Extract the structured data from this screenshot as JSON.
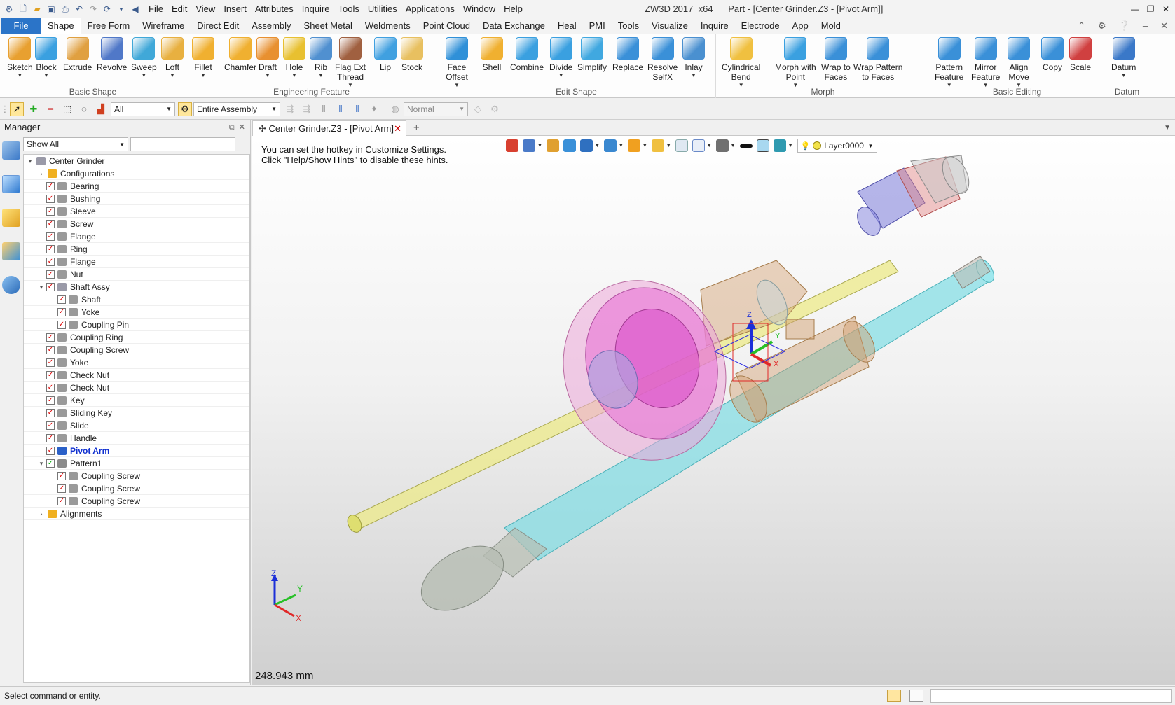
{
  "title_bar": {
    "menus": [
      "File",
      "Edit",
      "View",
      "Insert",
      "Attributes",
      "Inquire",
      "Tools",
      "Utilities",
      "Applications",
      "Window",
      "Help"
    ],
    "app_name": "ZW3D 2017",
    "arch": "x64",
    "window_title": "Part - [Center Grinder.Z3 - [Pivot Arm]]"
  },
  "ribbon_tabs": [
    "File",
    "Shape",
    "Free Form",
    "Wireframe",
    "Direct Edit",
    "Assembly",
    "Sheet Metal",
    "Weldments",
    "Point Cloud",
    "Data Exchange",
    "Heal",
    "PMI",
    "Tools",
    "Visualize",
    "Inquire",
    "Electrode",
    "App",
    "Mold"
  ],
  "active_tab": "Shape",
  "ribbon_groups": [
    {
      "label": "Basic Shape",
      "buttons": [
        {
          "l1": "Sketch",
          "l2": "",
          "arrow": true,
          "color": "#e8a030"
        },
        {
          "l1": "Block",
          "l2": "",
          "arrow": true,
          "color": "#3aa0e0"
        },
        {
          "l1": "Extrude",
          "l2": "",
          "arrow": false,
          "color": "#e0a040"
        },
        {
          "l1": "Revolve",
          "l2": "",
          "arrow": false,
          "color": "#5078c8"
        },
        {
          "l1": "Sweep",
          "l2": "",
          "arrow": true,
          "color": "#40a8d8"
        },
        {
          "l1": "Loft",
          "l2": "",
          "arrow": true,
          "color": "#e8b040"
        }
      ]
    },
    {
      "label": "Engineering Feature",
      "buttons": [
        {
          "l1": "Fillet",
          "l2": "",
          "arrow": true,
          "color": "#f0b030"
        },
        {
          "l1": "Chamfer",
          "l2": "",
          "arrow": false,
          "color": "#f0b030"
        },
        {
          "l1": "Draft",
          "l2": "",
          "arrow": true,
          "color": "#e89030"
        },
        {
          "l1": "Hole",
          "l2": "",
          "arrow": true,
          "color": "#e8c030"
        },
        {
          "l1": "Rib",
          "l2": "",
          "arrow": true,
          "color": "#5090d0"
        },
        {
          "l1": "Flag Ext",
          "l2": "Thread",
          "arrow": true,
          "color": "#a06040"
        },
        {
          "l1": "Lip",
          "l2": "",
          "arrow": false,
          "color": "#40a0e0"
        },
        {
          "l1": "Stock",
          "l2": "",
          "arrow": false,
          "color": "#e8c060"
        }
      ]
    },
    {
      "label": "Edit Shape",
      "buttons": [
        {
          "l1": "Face",
          "l2": "Offset",
          "arrow": true,
          "color": "#2f90d8"
        },
        {
          "l1": "Shell",
          "l2": "",
          "arrow": false,
          "color": "#f0b030"
        },
        {
          "l1": "Combine",
          "l2": "",
          "arrow": false,
          "color": "#3aa0e0"
        },
        {
          "l1": "Divide",
          "l2": "",
          "arrow": true,
          "color": "#3aa0e0"
        },
        {
          "l1": "Simplify",
          "l2": "",
          "arrow": false,
          "color": "#40a8e0"
        },
        {
          "l1": "Replace",
          "l2": "",
          "arrow": false,
          "color": "#3a90d8"
        },
        {
          "l1": "Resolve",
          "l2": "SelfX",
          "arrow": false,
          "color": "#3a90d8"
        },
        {
          "l1": "Inlay",
          "l2": "",
          "arrow": true,
          "color": "#4a90d0"
        }
      ]
    },
    {
      "label": "Morph",
      "buttons": [
        {
          "l1": "Cylindrical",
          "l2": "Bend",
          "arrow": true,
          "color": "#f0c040"
        },
        {
          "l1": "Morph with",
          "l2": "Point",
          "arrow": true,
          "color": "#3aa0e0"
        },
        {
          "l1": "Wrap to",
          "l2": "Faces",
          "arrow": false,
          "color": "#3a90d8"
        },
        {
          "l1": "Wrap Pattern",
          "l2": "to Faces",
          "arrow": false,
          "color": "#3a90d8"
        }
      ]
    },
    {
      "label": "Basic Editing",
      "buttons": [
        {
          "l1": "Pattern",
          "l2": "Feature",
          "arrow": true,
          "color": "#3a90d8"
        },
        {
          "l1": "Mirror",
          "l2": "Feature",
          "arrow": true,
          "color": "#3a90d8"
        },
        {
          "l1": "Align",
          "l2": "Move",
          "arrow": true,
          "color": "#3a90d8"
        },
        {
          "l1": "Copy",
          "l2": "",
          "arrow": false,
          "color": "#3a90d8"
        },
        {
          "l1": "Scale",
          "l2": "",
          "arrow": false,
          "color": "#d04040"
        }
      ]
    },
    {
      "label": "Datum",
      "buttons": [
        {
          "l1": "Datum",
          "l2": "",
          "arrow": true,
          "color": "#3a78c8"
        }
      ]
    }
  ],
  "command_bar": {
    "filter_value": "All",
    "scope_value": "Entire Assembly",
    "render_value": "Normal"
  },
  "manager": {
    "title": "Manager",
    "show_filter": "Show All",
    "search_placeholder": "",
    "tree": [
      {
        "label": "Center Grinder",
        "level": 0,
        "expander": "▾",
        "checkbox": false,
        "icon": "assembly-icon"
      },
      {
        "label": "Configurations",
        "level": 1,
        "expander": "›",
        "checkbox": false,
        "icon": "folder-icon"
      },
      {
        "label": "Bearing",
        "level": 1,
        "expander": "",
        "checkbox": true,
        "icon": "part-icon"
      },
      {
        "label": "Bushing",
        "level": 1,
        "expander": "",
        "checkbox": true,
        "icon": "part-icon"
      },
      {
        "label": "Sleeve",
        "level": 1,
        "expander": "",
        "checkbox": true,
        "icon": "part-icon"
      },
      {
        "label": "Screw",
        "level": 1,
        "expander": "",
        "checkbox": true,
        "icon": "part-icon"
      },
      {
        "label": "Flange",
        "level": 1,
        "expander": "",
        "checkbox": true,
        "icon": "part-icon"
      },
      {
        "label": "Ring",
        "level": 1,
        "expander": "",
        "checkbox": true,
        "icon": "part-icon"
      },
      {
        "label": "Flange",
        "level": 1,
        "expander": "",
        "checkbox": true,
        "icon": "part-icon"
      },
      {
        "label": "Nut",
        "level": 1,
        "expander": "",
        "checkbox": true,
        "icon": "part-icon"
      },
      {
        "label": "Shaft Assy",
        "level": 1,
        "expander": "▾",
        "checkbox": true,
        "icon": "subassembly-icon"
      },
      {
        "label": "Shaft",
        "level": 2,
        "expander": "",
        "checkbox": true,
        "icon": "part-icon"
      },
      {
        "label": "Yoke",
        "level": 2,
        "expander": "",
        "checkbox": true,
        "icon": "part-icon"
      },
      {
        "label": "Coupling Pin",
        "level": 2,
        "expander": "",
        "checkbox": true,
        "icon": "part-icon"
      },
      {
        "label": "Coupling Ring",
        "level": 1,
        "expander": "",
        "checkbox": true,
        "icon": "part-icon"
      },
      {
        "label": "Coupling Screw",
        "level": 1,
        "expander": "",
        "checkbox": true,
        "icon": "part-icon"
      },
      {
        "label": "Yoke",
        "level": 1,
        "expander": "",
        "checkbox": true,
        "icon": "part-icon"
      },
      {
        "label": "Check Nut",
        "level": 1,
        "expander": "",
        "checkbox": true,
        "icon": "part-icon"
      },
      {
        "label": "Check Nut",
        "level": 1,
        "expander": "",
        "checkbox": true,
        "icon": "part-icon"
      },
      {
        "label": "Key",
        "level": 1,
        "expander": "",
        "checkbox": true,
        "icon": "part-icon"
      },
      {
        "label": "Sliding Key",
        "level": 1,
        "expander": "",
        "checkbox": true,
        "icon": "part-icon"
      },
      {
        "label": "Slide",
        "level": 1,
        "expander": "",
        "checkbox": true,
        "icon": "part-icon"
      },
      {
        "label": "Handle",
        "level": 1,
        "expander": "",
        "checkbox": true,
        "icon": "part-icon"
      },
      {
        "label": "Pivot Arm",
        "level": 1,
        "expander": "",
        "checkbox": true,
        "icon": "active-part-icon",
        "active": true
      },
      {
        "label": "Pattern1",
        "level": 1,
        "expander": "▾",
        "checkbox": true,
        "icon": "pattern-icon",
        "green": true
      },
      {
        "label": "Coupling Screw",
        "level": 2,
        "expander": "",
        "checkbox": true,
        "icon": "part-icon"
      },
      {
        "label": "Coupling Screw",
        "level": 2,
        "expander": "",
        "checkbox": true,
        "icon": "part-icon"
      },
      {
        "label": "Coupling Screw",
        "level": 2,
        "expander": "",
        "checkbox": true,
        "icon": "part-icon"
      },
      {
        "label": "Alignments",
        "level": 1,
        "expander": "›",
        "checkbox": false,
        "icon": "folder-icon"
      }
    ]
  },
  "document": {
    "tab_label": "Center Grinder.Z3 - [Pivot Arm]",
    "layer": "Layer0000",
    "hint_line1": "You can set the hotkey in Customize Settings.",
    "hint_line2": "Click \"Help/Show Hints\" to disable these hints.",
    "scale_readout": "248.943 mm",
    "axis_labels": {
      "x": "X",
      "y": "Y",
      "z": "Z"
    }
  },
  "status": {
    "text": "Select command or entity."
  },
  "colors": {
    "file_tab": "#2b74c8",
    "shaft": "#e8e060",
    "bar": "#5ed6dc",
    "flange": "#e070c0",
    "housing": "#d2a070",
    "head": "#7a7ad8",
    "active_label": "#1030d0"
  }
}
